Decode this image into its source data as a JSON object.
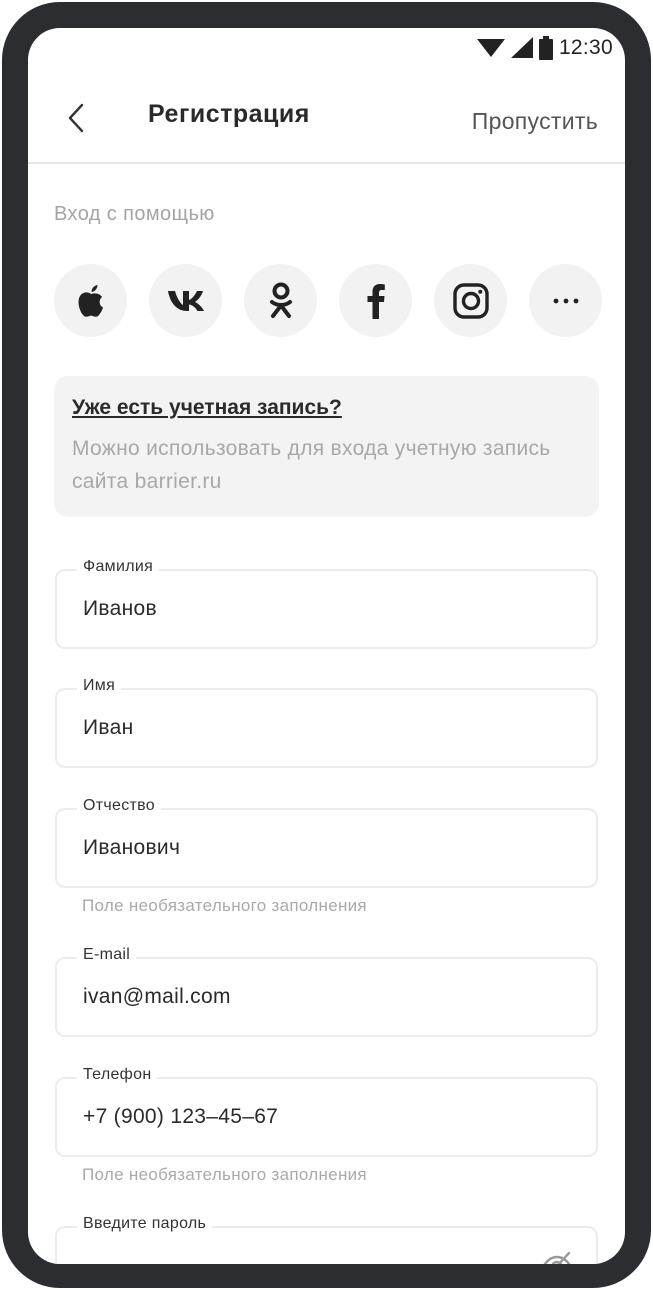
{
  "status_bar": {
    "time": "12:30",
    "icons": [
      "wifi-icon",
      "signal-icon",
      "battery-icon"
    ]
  },
  "header": {
    "title": "Регистрация",
    "skip_label": "Пропустить",
    "back_icon": "chevron-left-icon"
  },
  "login_with": {
    "label": "Вход с помощью",
    "providers": [
      "apple",
      "vk",
      "odnoklassniki",
      "facebook",
      "instagram",
      "more"
    ]
  },
  "account_card": {
    "link": "Уже есть учетная запись?",
    "text": "Можно использовать для входа учетную запись сайта barrier.ru"
  },
  "form": {
    "last_name": {
      "label": "Фамилия",
      "value": "Иванов"
    },
    "first_name": {
      "label": "Имя",
      "value": "Иван"
    },
    "patronymic": {
      "label": "Отчество",
      "value": "Иванович",
      "hint": "Поле необязательного заполнения"
    },
    "email": {
      "label": "E-mail",
      "value": "ivan@mail.com"
    },
    "phone": {
      "label": "Телефон",
      "value": "+7 (900) 123–45–67",
      "hint": "Поле необязательного заполнения"
    },
    "password": {
      "label": "Введите пароль"
    }
  },
  "colors": {
    "frame": "#2b2d31",
    "text_primary": "#2a2a2a",
    "text_muted": "#a8a8a8",
    "social_bg": "#f2f2f2",
    "card_bg": "#f3f3f3",
    "field_border": "#ececec"
  }
}
